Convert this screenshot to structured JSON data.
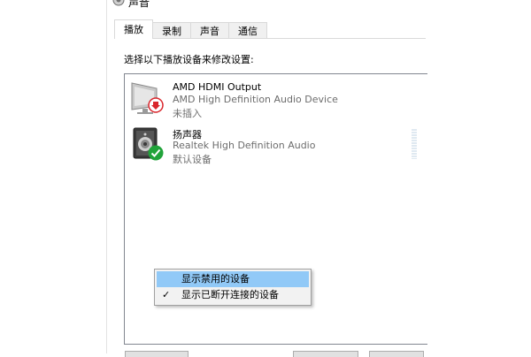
{
  "window": {
    "title": "声音"
  },
  "tabs": [
    {
      "label": "播放",
      "active": true
    },
    {
      "label": "录制",
      "active": false
    },
    {
      "label": "声音",
      "active": false
    },
    {
      "label": "通信",
      "active": false
    }
  ],
  "playback": {
    "instruction": "选择以下播放设备来修改设置:",
    "devices": [
      {
        "name": "AMD HDMI Output",
        "description": "AMD High Definition Audio Device",
        "status": "未插入",
        "icon": "monitor-icon",
        "badge": "unplugged-icon",
        "badge_color": "#d9262c"
      },
      {
        "name": "扬声器",
        "description": "Realtek High Definition Audio",
        "status": "默认设备",
        "icon": "speaker-icon",
        "badge": "checkmark-icon",
        "badge_color": "#21a33a"
      }
    ]
  },
  "context_menu": {
    "items": [
      {
        "label": "显示禁用的设备",
        "checked": false,
        "highlighted": true
      },
      {
        "label": "显示已断开连接的设备",
        "checked": true,
        "highlighted": false
      }
    ]
  },
  "colors": {
    "menu_highlight": "#91c9f7",
    "secondary_text": "#6d6d6d"
  }
}
